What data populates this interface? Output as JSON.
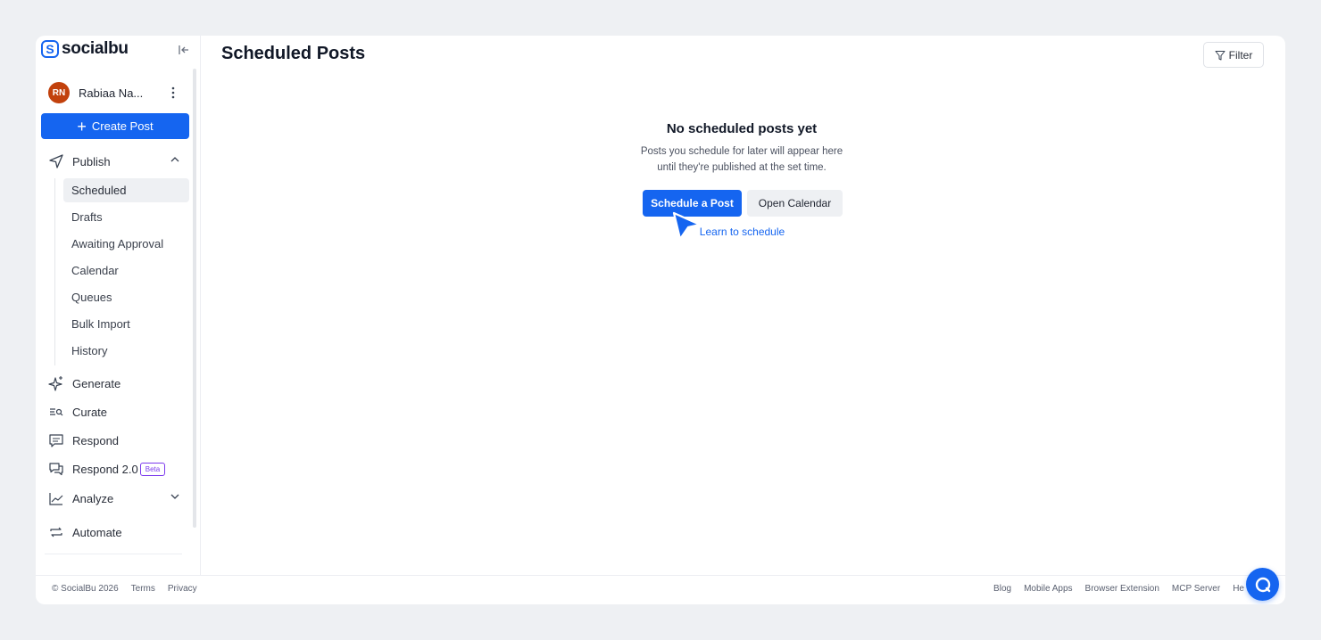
{
  "brand": {
    "logo_letter": "S",
    "name": "socialbu",
    "accent": "#1565f0"
  },
  "user": {
    "initials": "RN",
    "name": "Rabiaa Na..."
  },
  "sidebar": {
    "create_label": "Create Post",
    "publish": {
      "label": "Publish",
      "items": [
        {
          "label": "Scheduled",
          "active": true
        },
        {
          "label": "Drafts"
        },
        {
          "label": "Awaiting Approval"
        },
        {
          "label": "Calendar"
        },
        {
          "label": "Queues"
        },
        {
          "label": "Bulk Import"
        },
        {
          "label": "History"
        }
      ]
    },
    "items": [
      {
        "label": "Generate",
        "icon": "sparkle-icon"
      },
      {
        "label": "Curate",
        "icon": "curate-icon"
      },
      {
        "label": "Respond",
        "icon": "message-icon"
      },
      {
        "label": "Respond 2.0",
        "icon": "chat-icon",
        "badge": "Beta"
      },
      {
        "label": "Analyze",
        "icon": "chart-icon"
      },
      {
        "label": "Automate",
        "icon": "repeat-icon"
      }
    ]
  },
  "header": {
    "title": "Scheduled Posts",
    "filter_label": "Filter"
  },
  "empty_state": {
    "title": "No scheduled posts yet",
    "line1": "Posts you schedule for later will appear here",
    "line2": "until they're published at the set time.",
    "primary": "Schedule a Post",
    "secondary": "Open Calendar",
    "link": "Learn to schedule"
  },
  "footer": {
    "copyright": "© SocialBu 2026",
    "terms": "Terms",
    "privacy": "Privacy",
    "links": [
      "Blog",
      "Mobile Apps",
      "Browser Extension",
      "MCP Server",
      "He"
    ]
  }
}
